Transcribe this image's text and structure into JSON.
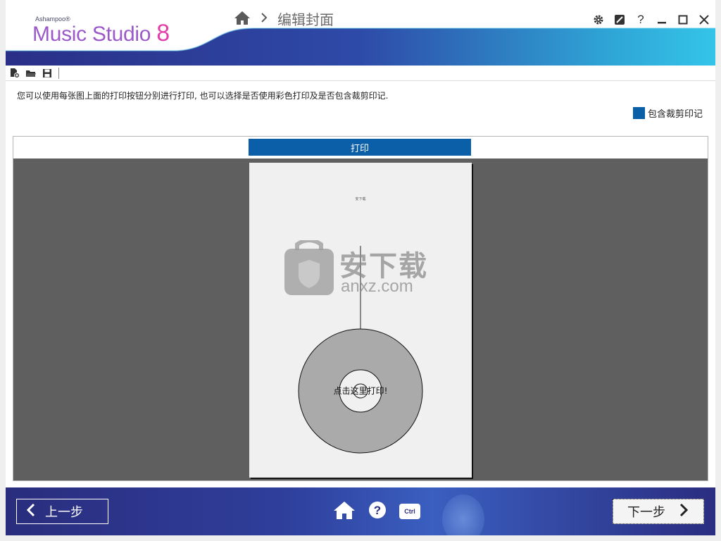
{
  "app": {
    "brand": "Ashampoo®",
    "product": "Music Studio ",
    "version": "8",
    "page_title": "编辑封面"
  },
  "window_controls": [
    "gear-icon",
    "skin-icon",
    "help-icon",
    "minimize-icon",
    "maximize-icon",
    "close-icon"
  ],
  "toolbar": {
    "icons": [
      "new-file-icon",
      "open-folder-icon",
      "save-icon"
    ]
  },
  "instruction": "您可以使用每张图上面的打印按钮分别进行打印, 也可以选择是否使用彩色打印及是否包含裁剪印记.",
  "crop_marks_label": "包含裁剪印记",
  "print": {
    "button_label": "打印",
    "paper_small_text": "安下载",
    "disc_label": "点击这里打印!"
  },
  "watermark": {
    "cn": "安下载",
    "en": "anxz.com"
  },
  "footer": {
    "back_label": "上一步",
    "next_label": "下一步",
    "ctrl_label": "Ctrl"
  },
  "colors": {
    "accent_blue": "#0b5ea8",
    "footer_blue": "#2a2d7d",
    "logo_purple": "#9b59c9",
    "logo_pink": "#e33fa8"
  }
}
